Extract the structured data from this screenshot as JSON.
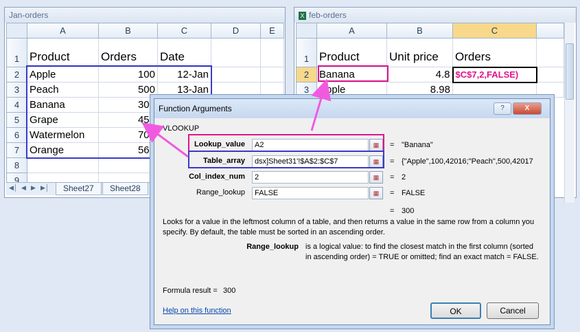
{
  "jan": {
    "title": "Jan-orders",
    "cols": [
      "A",
      "B",
      "C",
      "D",
      "E"
    ],
    "rows": [
      {
        "n": "1",
        "a": "Product",
        "b": "Orders",
        "c": "Date"
      },
      {
        "n": "2",
        "a": "Apple",
        "b": "100",
        "c": "12-Jan"
      },
      {
        "n": "3",
        "a": "Peach",
        "b": "500",
        "c": "13-Jan"
      },
      {
        "n": "4",
        "a": "Banana",
        "b": "300",
        "c": ""
      },
      {
        "n": "5",
        "a": "Grape",
        "b": "450",
        "c": ""
      },
      {
        "n": "6",
        "a": "Watermelon",
        "b": "700",
        "c": ""
      },
      {
        "n": "7",
        "a": "Orange",
        "b": "560",
        "c": ""
      },
      {
        "n": "8",
        "a": "",
        "b": "",
        "c": ""
      },
      {
        "n": "9",
        "a": "",
        "b": "",
        "c": ""
      }
    ],
    "tabs": [
      "Sheet27",
      "Sheet28"
    ]
  },
  "feb": {
    "title": "feb-orders",
    "cols": [
      "A",
      "B",
      "C"
    ],
    "rows": [
      {
        "n": "1",
        "a": "Product",
        "b": "Unit price",
        "c": "Orders"
      },
      {
        "n": "2",
        "a": "Banana",
        "b": "4.8",
        "c": "$C$7,2,FALSE)"
      },
      {
        "n": "3",
        "a": "Apple",
        "b": "8.98",
        "c": ""
      }
    ]
  },
  "dialog": {
    "title": "Function Arguments",
    "help_btn": "?",
    "close_btn": "X",
    "fn_name": "VLOOKUP",
    "args": [
      {
        "label": "Lookup_value",
        "value": "A2",
        "result": "\"Banana\""
      },
      {
        "label": "Table_array",
        "value": "dsx]Sheet31'!$A$2:$C$7",
        "result": "{\"Apple\",100,42016;\"Peach\",500,42017"
      },
      {
        "label": "Col_index_num",
        "value": "2",
        "result": "2"
      },
      {
        "label": "Range_lookup",
        "value": "FALSE",
        "result": "FALSE"
      }
    ],
    "eq": "=",
    "total": "300",
    "description": "Looks for a value in the leftmost column of a table, and then returns a value in the same row from a column you specify. By default, the table must be sorted in an ascending order.",
    "arg_name": "Range_lookup",
    "arg_desc": "is a logical value: to find the closest match in the first column (sorted in ascending order) = TRUE or omitted; find an exact match = FALSE.",
    "formula_label": "Formula result =",
    "formula_result": "300",
    "help_link": "Help on this function",
    "ok": "OK",
    "cancel": "Cancel"
  },
  "colors": {
    "highlight": "#e0148a",
    "range_box": "#3a3ac8",
    "selected_col": "#f8d88a"
  }
}
